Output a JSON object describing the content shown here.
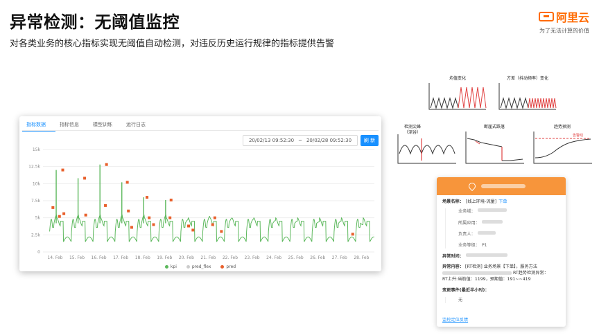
{
  "header": {
    "title": "异常检测：无阈值监控",
    "subtitle": "对各类业务的核心指标实现无阈值自动检测，对违反历史运行规律的指标提供告警"
  },
  "logo": {
    "text": "阿里云",
    "slogan": "为了无法计算的价值",
    "color": "#ff6a00"
  },
  "panel": {
    "tabs": [
      {
        "label": "指标数据",
        "active": true
      },
      {
        "label": "指标信息",
        "active": false
      },
      {
        "label": "模型训练",
        "active": false
      },
      {
        "label": "运行日志",
        "active": false
      }
    ],
    "date_start": "20/02/13 09:52:30",
    "date_sep": "~",
    "date_end": "20/02/28 09:52:30",
    "refresh_label": "刷 新",
    "legend": [
      {
        "name": "kpi",
        "color": "#5cb85c"
      },
      {
        "name": "pred_flex",
        "color": "#cccccc"
      },
      {
        "name": "pred",
        "color": "#e8602c"
      }
    ]
  },
  "chart_data": {
    "type": "line",
    "title": "",
    "xlabel": "",
    "ylabel": "",
    "ylim": [
      0,
      15000
    ],
    "y_ticks": [
      "0",
      "2.5k",
      "5k",
      "7.5k",
      "10k",
      "12.5k",
      "15k"
    ],
    "x_ticks": [
      "14. Feb",
      "15. Feb",
      "16. Feb",
      "17. Feb",
      "18. Feb",
      "19. Feb",
      "20. Feb",
      "21. Feb",
      "22. Feb",
      "23. Feb",
      "24. Feb",
      "25. Feb",
      "26. Feb",
      "27. Feb",
      "28. Feb"
    ],
    "series": [
      {
        "name": "kpi",
        "color": "#5cb85c",
        "daily_peaks": [
          12000,
          10800,
          12800,
          10200,
          8000,
          7600,
          4700,
          5200,
          4900,
          4800,
          4600,
          4500,
          4400,
          4500,
          4000
        ],
        "daily_base": 3000
      }
    ],
    "anomalies": [
      {
        "x": "13.9 Feb",
        "y": 6500
      },
      {
        "x": "14.2 Feb",
        "y": 5200
      },
      {
        "x": "14.35 Feb",
        "y": 12000
      },
      {
        "x": "14.4 Feb",
        "y": 5600
      },
      {
        "x": "15.35 Feb",
        "y": 10800
      },
      {
        "x": "15.4 Feb",
        "y": 5400
      },
      {
        "x": "16.35 Feb",
        "y": 12800
      },
      {
        "x": "16.3 Feb",
        "y": 6800
      },
      {
        "x": "17.3 Feb",
        "y": 10200
      },
      {
        "x": "17.35 Feb",
        "y": 6000
      },
      {
        "x": "17.5 Feb",
        "y": 3600
      },
      {
        "x": "18.2 Feb",
        "y": 8000
      },
      {
        "x": "18.3 Feb",
        "y": 5000
      },
      {
        "x": "18.5 Feb",
        "y": 4000
      },
      {
        "x": "19.3 Feb",
        "y": 7600
      },
      {
        "x": "19.25 Feb",
        "y": 5000
      },
      {
        "x": "20.1 Feb",
        "y": 3800
      },
      {
        "x": "20.3 Feb",
        "y": 3200
      },
      {
        "x": "21.2 Feb",
        "y": 4000
      },
      {
        "x": "21.3 Feb",
        "y": 5000
      },
      {
        "x": "21.6 Feb",
        "y": 3000
      },
      {
        "x": "27.6 Feb",
        "y": 2600
      }
    ]
  },
  "patterns": [
    {
      "label": "均值变化"
    },
    {
      "label": "方差（抖动频率）变化"
    },
    {
      "label": "检测尖峰",
      "label2": "（深谷）"
    },
    {
      "label": "断崖式跌落"
    },
    {
      "label": "趋势预测",
      "note": "告警线"
    }
  ],
  "card": {
    "scene_label": "场景名称：",
    "scene_value": "[线上环境-流量]",
    "scene_link": "下单",
    "biz_label": "业务域：",
    "app_label": "所属应用：",
    "owner_label": "负责人：",
    "level_label": "业务等级：",
    "level_value": "P1",
    "time_label": "异常时间：",
    "content_label": "异常内容：",
    "content_value": "[RT检测] 业务场景【下单】，服务方法",
    "content_extra": "RT趋势检测异常：",
    "content_line2": "RT上升:当前值：1199，预期值：191~~419",
    "change_label": "变更事件(最近半小时)：",
    "change_value": "无",
    "feedback_link": "监控定位反馈"
  }
}
